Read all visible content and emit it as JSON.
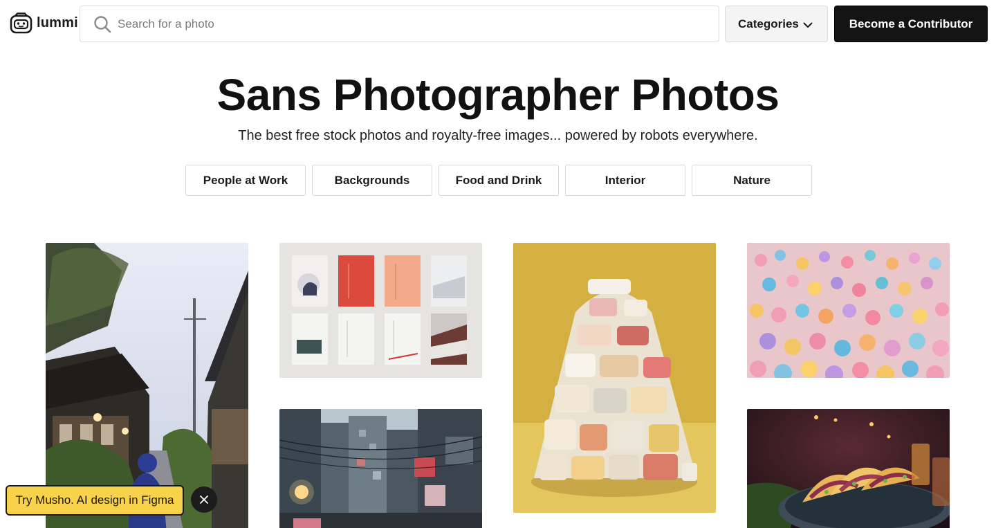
{
  "header": {
    "logo_text": "lummi",
    "search_placeholder": "Search for a photo",
    "categories_label": "Categories",
    "contributor_label": "Become a Contributor"
  },
  "hero": {
    "title": "Sans Photographer Photos",
    "subtitle": "The best free stock photos and royalty-free images... powered by robots everywhere."
  },
  "chips": [
    "People at Work",
    "Backgrounds",
    "Food and Drink",
    "Interior",
    "Nature"
  ],
  "promo": {
    "label": "Try Musho. AI design in Figma",
    "color": "#f7d24a"
  },
  "icons": {
    "logo": "robot-face-icon",
    "search": "search-icon",
    "categories": "chevron-down-icon",
    "promo_close": "close-icon"
  },
  "colors": {
    "primary_button": "#141414",
    "border": "#dcdcdc"
  }
}
